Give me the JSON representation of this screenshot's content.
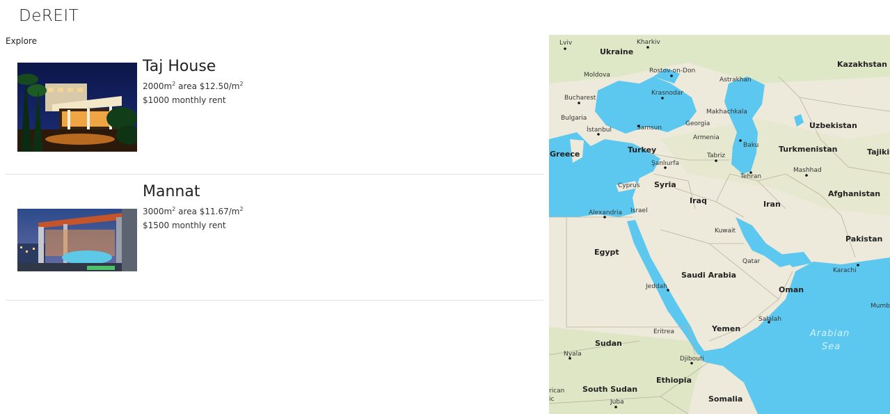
{
  "app": {
    "brand": "DeREIT"
  },
  "nav": {
    "explore_label": "Explore"
  },
  "listings": [
    {
      "name": "Taj House",
      "area": "2000",
      "area_unit": "m",
      "area_suffix": "area",
      "price": "$12.50/m",
      "rent": "$1000 monthly rent"
    },
    {
      "name": "Mannat",
      "area": "3000",
      "area_unit": "m",
      "area_suffix": "area",
      "price": "$11.67/m",
      "rent": "$1500 monthly rent"
    }
  ],
  "map": {
    "sea_color": "#5cc8ef",
    "land_color": "#eeeadb",
    "labels": {
      "lviv": "Lviv",
      "kharkiv": "Kharkiv",
      "ukraine": "Ukraine",
      "kazakhstan": "Kazakhstan",
      "moldova": "Moldova",
      "rostov": "Rostov-on-Don",
      "astrakhan": "Astrakhan",
      "bucharest": "Bucharest",
      "krasnodar": "Krasnodar",
      "bulgaria": "Bulgaria",
      "makhachkala": "Makhachkala",
      "uzbekistan": "Uzbekistan",
      "istanbul": "İstanbul",
      "samsun": "Samsun",
      "georgia": "Georgia",
      "armenia": "Armenia",
      "baku": "Baku",
      "greece": "Greece",
      "turkey": "Turkey",
      "tabriz": "Tabriz",
      "turkmenistan": "Turkmenistan",
      "tajikistan": "Tajikis",
      "sanliurfa": "Şanlıurfa",
      "mashhad": "Mashhad",
      "cyprus": "Cyprus",
      "syria": "Syria",
      "tehran": "Tehran",
      "afghanistan": "Afghanistan",
      "iraq": "Iraq",
      "iran": "Iran",
      "alexandria": "Alexandria",
      "israel": "Israel",
      "kuwait": "Kuwait",
      "pakistan": "Pakistan",
      "egypt": "Egypt",
      "qatar": "Qatar",
      "karachi": "Karachi",
      "saudi_arabia": "Saudi Arabia",
      "jeddah": "Jeddah",
      "oman": "Oman",
      "mumbai": "Mumb",
      "salalah": "Salalah",
      "yemen": "Yemen",
      "eritrea": "Eritrea",
      "arabian": "Arabian",
      "sea": "Sea",
      "sudan": "Sudan",
      "nyala": "Nyala",
      "djibouti": "Djibouti",
      "ethiopia": "Ethiopia",
      "rican": "rican",
      "ic": "ic",
      "south_sudan": "South Sudan",
      "somalia": "Somalia",
      "juba": "Juba"
    }
  }
}
